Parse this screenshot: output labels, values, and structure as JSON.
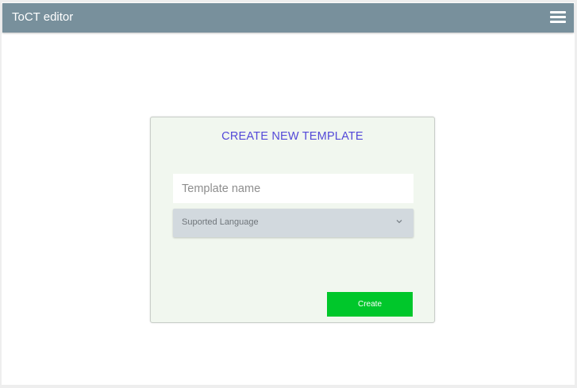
{
  "app": {
    "title": "ToCT editor"
  },
  "card": {
    "title": "CREATE NEW TEMPLATE",
    "template_name_placeholder": "Template name",
    "language_select_label": "Suported Language",
    "create_label": "Create"
  },
  "colors": {
    "topbar": "#78909c",
    "card_background": "#f1f7ef",
    "title_accent": "#5348d8",
    "select_background": "#d2d9de",
    "create_button": "#00c72b"
  },
  "icons": {
    "menu": "hamburger-menu-icon",
    "dropdown": "chevron-down-icon"
  }
}
